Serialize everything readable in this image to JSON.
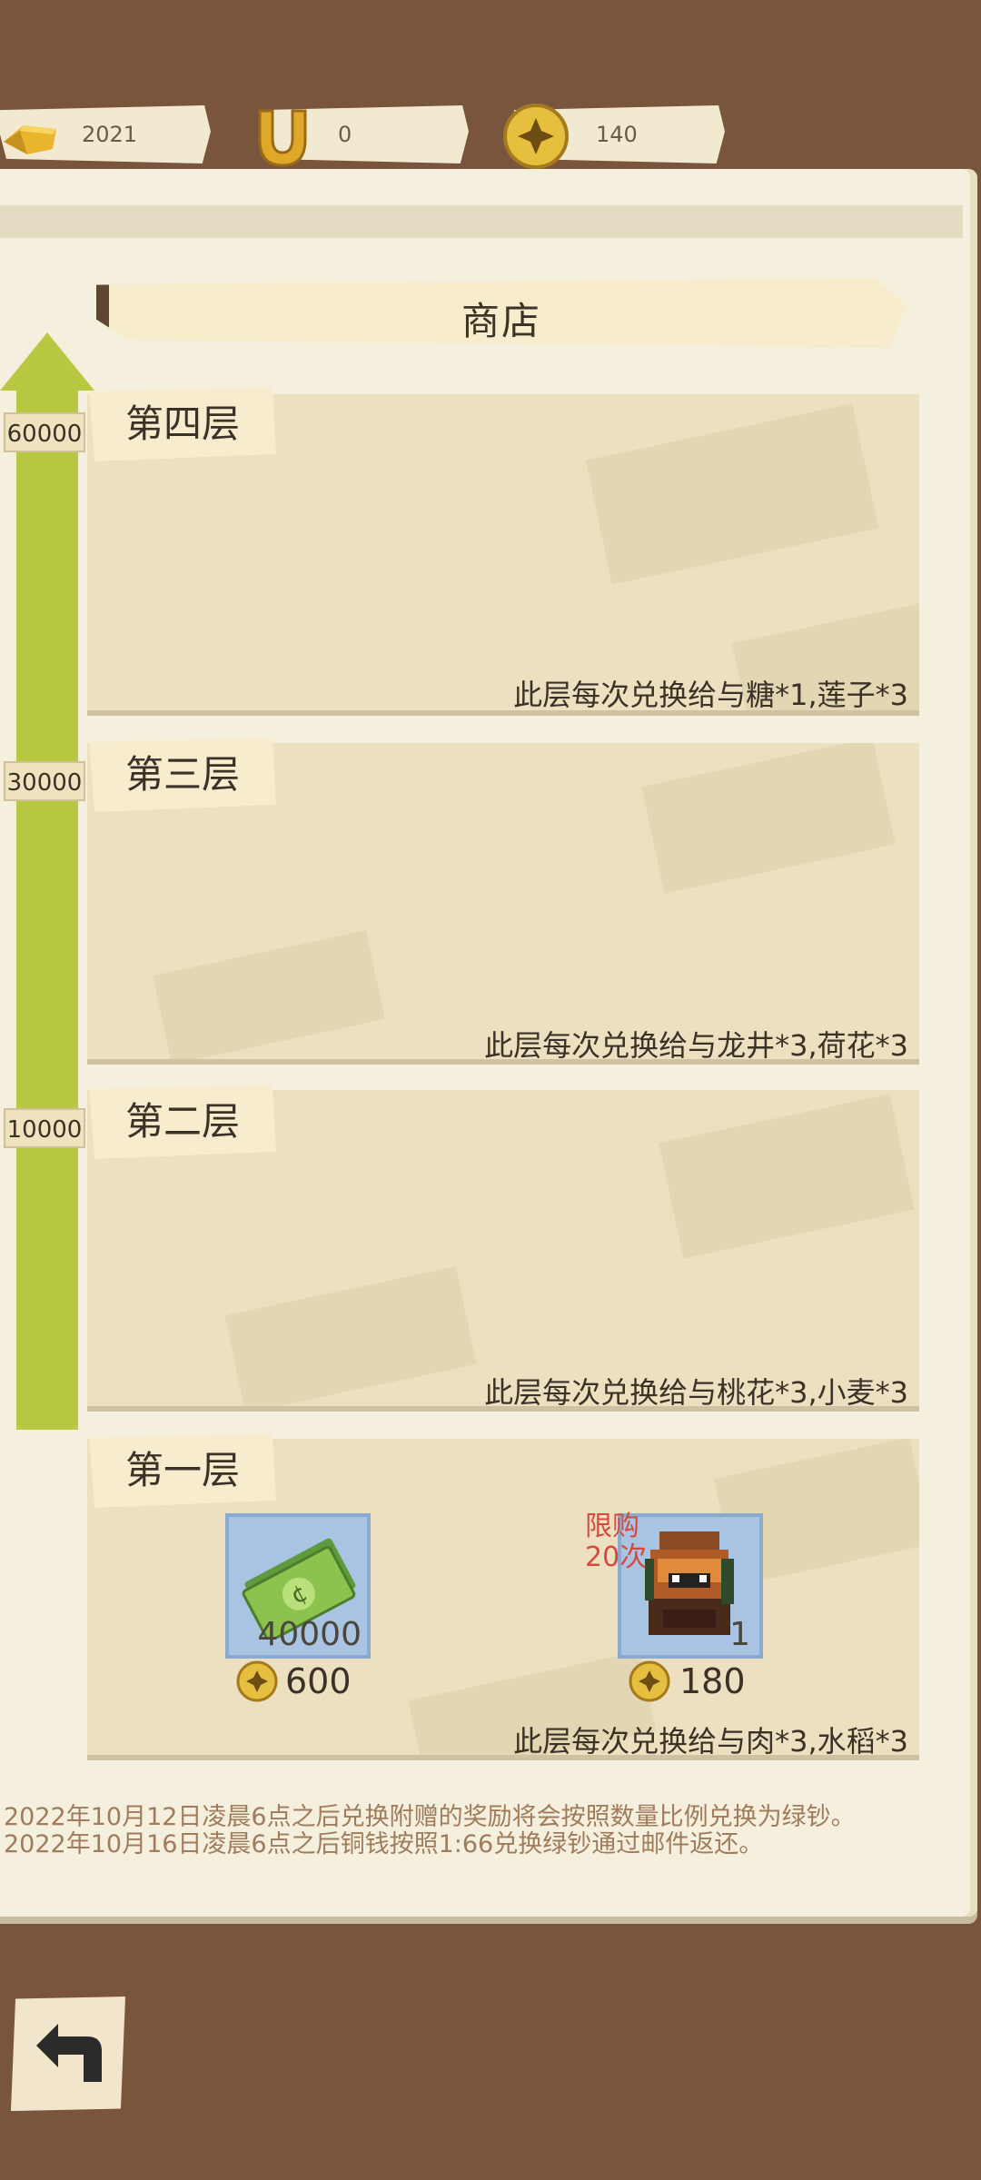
{
  "currencies": [
    {
      "name": "gold-bar",
      "value": "2021"
    },
    {
      "name": "horseshoe",
      "value": "0"
    },
    {
      "name": "copper-coin",
      "value": "140"
    }
  ],
  "shop": {
    "title": "商店"
  },
  "tiers": [
    {
      "label": "第四层",
      "threshold": "60000",
      "desc": "此层每次兑换给与糖*1,莲子*3"
    },
    {
      "label": "第三层",
      "threshold": "30000",
      "desc": "此层每次兑换给与龙井*3,荷花*3"
    },
    {
      "label": "第二层",
      "threshold": "10000",
      "desc": "此层每次兑换给与桃花*3,小麦*3"
    },
    {
      "label": "第一层",
      "desc": "此层每次兑换给与肉*3,水稻*3"
    }
  ],
  "items": [
    {
      "icon": "cash-icon",
      "count": "40000",
      "price": "600"
    },
    {
      "icon": "backpack-icon",
      "count": "1",
      "price": "180",
      "limit_line1": "限购",
      "limit_line2": "20次"
    }
  ],
  "notices": [
    "2022年10月12日凌晨6点之后兑换附赠的奖励将会按照数量比例兑换为绿钞。",
    "2022年10月16日凌晨6点之后铜钱按照1:66兑换绿钞通过邮件返还。"
  ],
  "colors": {
    "background": "#7a553d",
    "panel": "#f5f0dd",
    "tier_card": "#ece0c1",
    "progress_arrow": "#b9c843",
    "limit_text": "#d64a3d",
    "item_frame": "#a8c4e2"
  }
}
